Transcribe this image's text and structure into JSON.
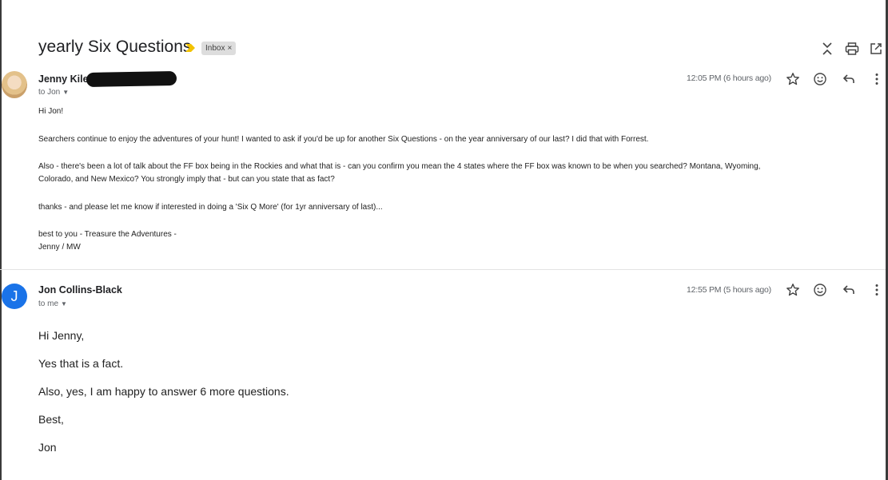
{
  "thread": {
    "subject": "yearly Six Questions",
    "label": "Inbox",
    "label_remove": "×"
  },
  "toolbar": {
    "icons": [
      "expand-collapse-icon",
      "print-icon",
      "open-in-new-window-icon"
    ]
  },
  "messages": [
    {
      "sender": "Jenny Kile",
      "sender_redacted": true,
      "recipient": "to Jon",
      "timestamp": "12:05 PM (6 hours ago)",
      "avatar": "photo",
      "body": [
        "Hi Jon!",
        "Searchers continue to enjoy the adventures of your hunt!   I wanted to ask if you'd be up for another Six Questions - on the year anniversary of our last?  I did that with Forrest.",
        "Also - there's been a lot of talk about the FF box being in the Rockies and what that is - can you confirm you mean the 4 states where the FF box was known to be when you searched?  Montana, Wyoming,",
        "Colorado, and New Mexico?   You strongly imply that - but can you state that as fact?",
        "thanks - and please let me know if interested in doing a 'Six Q More' (for 1yr anniversary of last)...",
        "best to you - Treasure the Adventures -",
        "Jenny / MW"
      ]
    },
    {
      "sender": "Jon Collins-Black",
      "recipient": "to me",
      "timestamp": "12:55 PM (5 hours ago)",
      "avatar_letter": "J",
      "avatar_color": "#1a73e8",
      "body": [
        "Hi Jenny,",
        "Yes that is a fact.",
        "Also, yes, I am happy to answer 6 more questions.",
        "Best,",
        "Jon"
      ]
    }
  ],
  "message_actions": [
    "star-icon",
    "emoji-reaction-icon",
    "reply-icon",
    "more-options-icon"
  ],
  "colors": {
    "importance_marker": "#f2c200",
    "avatar_blue": "#1a73e8",
    "label_chip_bg": "#dddddd"
  }
}
